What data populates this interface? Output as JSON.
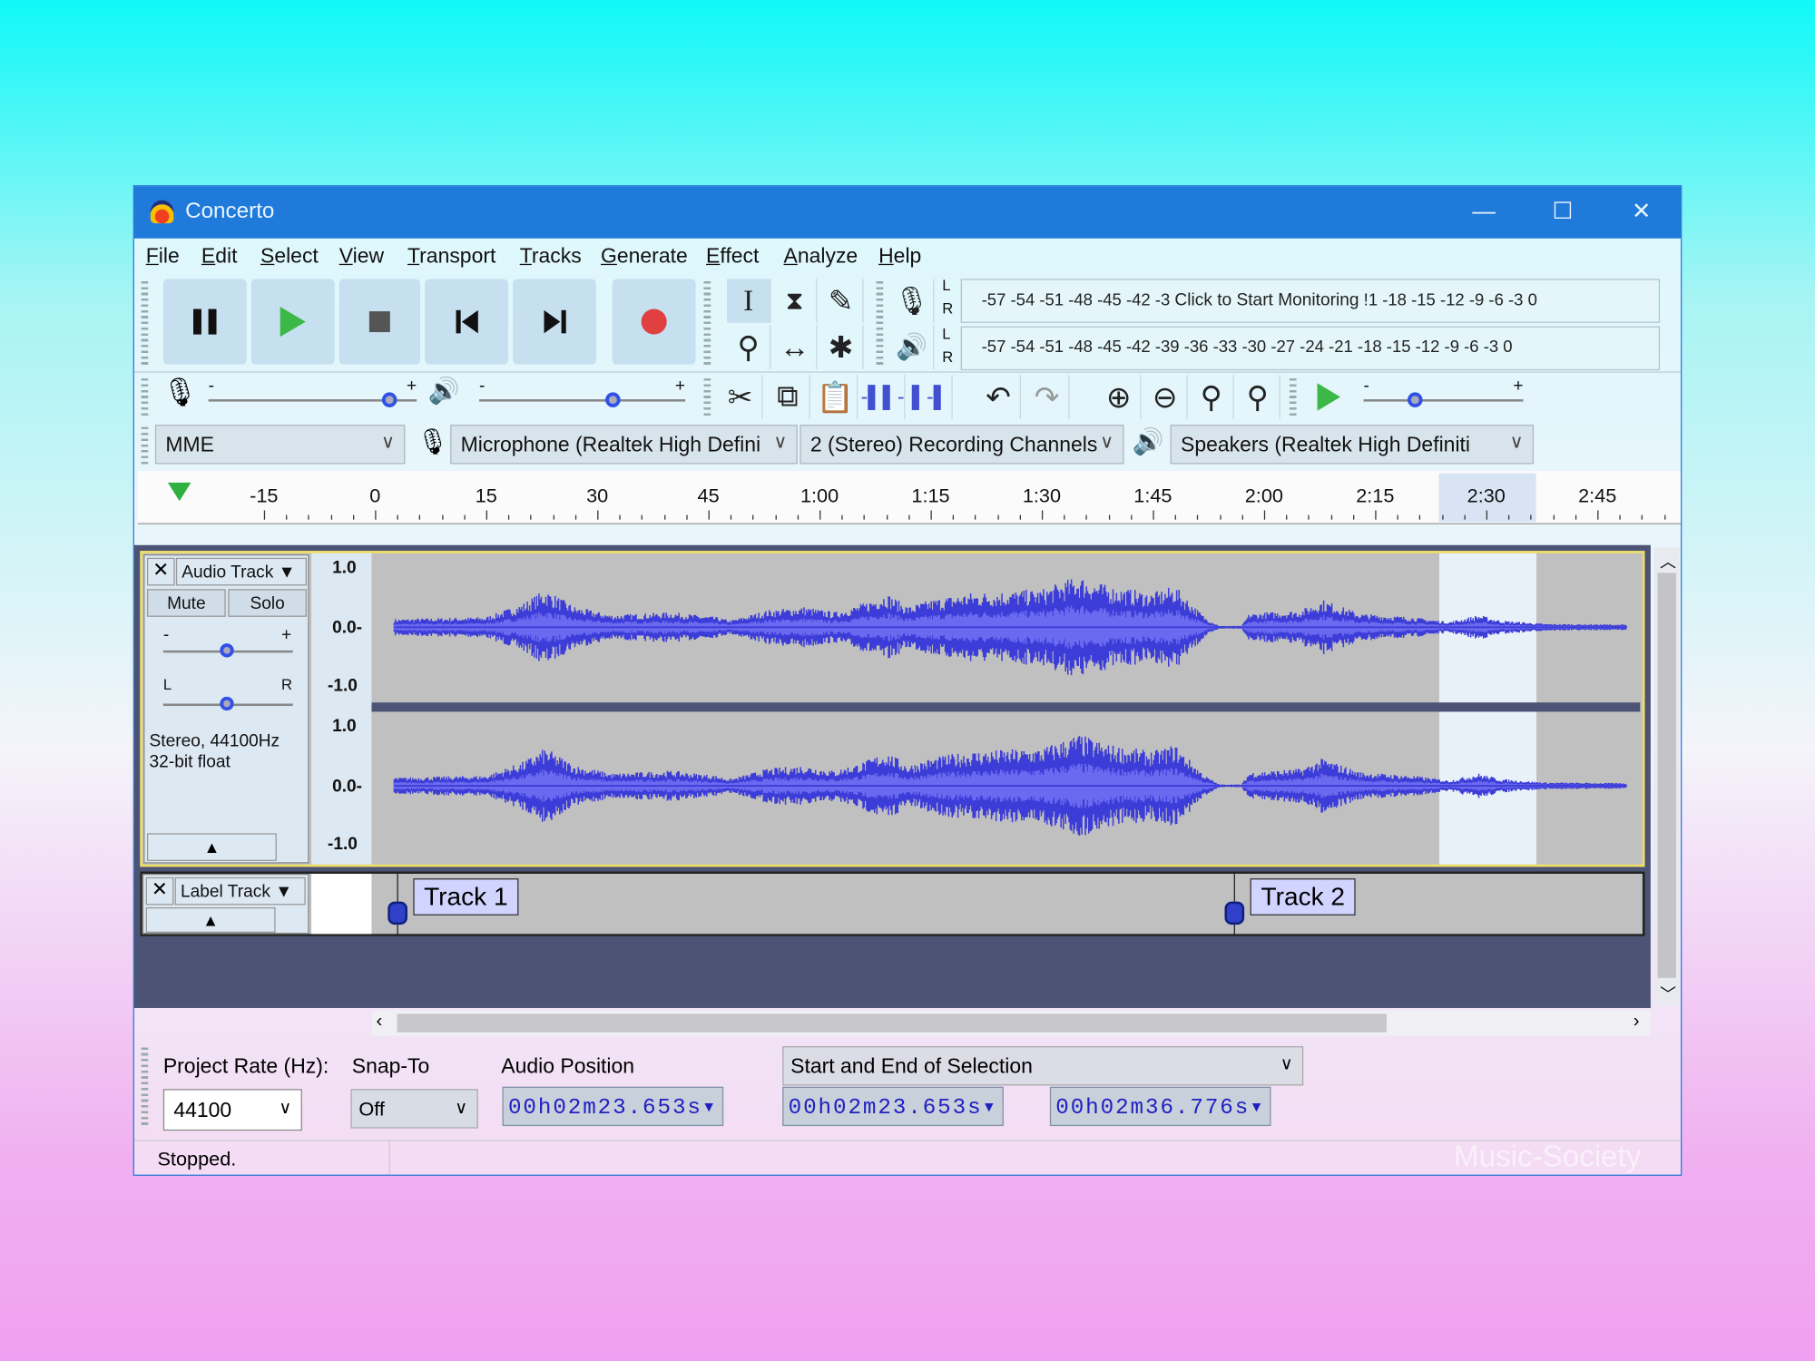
{
  "window": {
    "title": "Concerto",
    "minimize": "—",
    "maximize": "☐",
    "close": "✕"
  },
  "menu": [
    "File",
    "Edit",
    "Select",
    "View",
    "Transport",
    "Tracks",
    "Generate",
    "Effect",
    "Analyze",
    "Help"
  ],
  "meters": {
    "record_ticks": "-57 -54 -51 -48 -45 -42 -3",
    "record_prompt": "Click to Start Monitoring",
    "record_ticks_end": "!1 -18 -15 -12  -9  -6  -3  0",
    "play_ticks": "-57 -54 -51 -48 -45 -42 -39 -36 -33 -30 -27 -24 -21 -18 -15 -12  -9  -6  -3  0",
    "L": "L",
    "R": "R"
  },
  "sliders": {
    "minus": "-",
    "plus": "+",
    "recording_volume": 0.9,
    "playback_volume": 0.66,
    "play_speed": 0.3
  },
  "devices": {
    "host": "MME",
    "input": "Microphone (Realtek High Defini",
    "channels": "2 (Stereo) Recording Channels",
    "output": "Speakers (Realtek High Definiti"
  },
  "ruler": {
    "labels": [
      "-15",
      "0",
      "15",
      "30",
      "45",
      "1:00",
      "1:15",
      "1:30",
      "1:45",
      "2:00",
      "2:15",
      "2:30",
      "2:45"
    ]
  },
  "audio_track": {
    "name": "Audio Track",
    "mute": "Mute",
    "solo": "Solo",
    "gain_minus": "-",
    "gain_plus": "+",
    "pan_left": "L",
    "pan_right": "R",
    "info1": "Stereo, 44100Hz",
    "info2": "32-bit float",
    "scale": [
      "1.0",
      "0.0-",
      "-1.0"
    ],
    "color": "#3c3cd8"
  },
  "label_track": {
    "name": "Label Track",
    "labels": [
      {
        "text": "Track 1",
        "time_s": 3
      },
      {
        "text": "Track 2",
        "time_s": 116
      }
    ]
  },
  "selection": {
    "start_s": 143.653,
    "end_s": 156.776
  },
  "selection_toolbar": {
    "project_rate_label": "Project Rate (Hz):",
    "project_rate": "44100",
    "snap_label": "Snap-To",
    "snap": "Off",
    "audio_position_label": "Audio Position",
    "selection_mode": "Start and End of Selection",
    "audio_position": "00h02m23.653s",
    "sel_start": "00h02m23.653s",
    "sel_end": "00h02m36.776s"
  },
  "status": "Stopped.",
  "watermark": "Music-Society"
}
